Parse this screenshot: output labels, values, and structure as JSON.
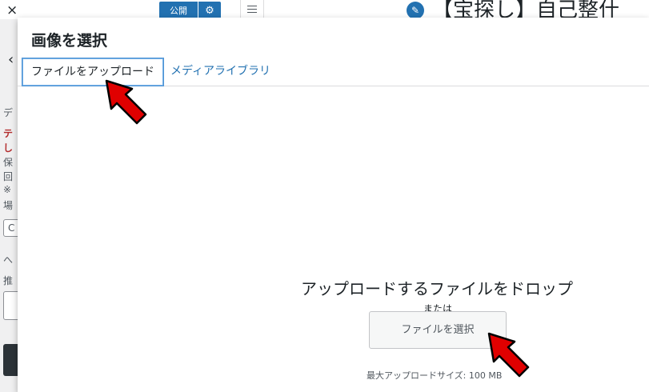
{
  "background": {
    "close_glyph": "×",
    "publish_label": "公開",
    "gear_icon": "gear-icon",
    "title_fragment": "【宝探し】自己整什",
    "side_fragments": [
      "デ",
      "テ",
      "し",
      "保",
      "回",
      "※",
      "場",
      "C",
      "へ",
      "推"
    ]
  },
  "modal": {
    "title": "画像を選択",
    "tabs": [
      {
        "label": "ファイルをアップロード",
        "active": true
      },
      {
        "label": "メディアライブラリ",
        "active": false
      }
    ],
    "upload": {
      "drop_text": "アップロードするファイルをドロップ",
      "or_text": "または",
      "select_button_label": "ファイルを選択",
      "max_size_text": "最大アップロードサイズ: 100 MB"
    }
  },
  "colors": {
    "accent": "#2271b1",
    "annotation_arrow": "#e00000"
  }
}
